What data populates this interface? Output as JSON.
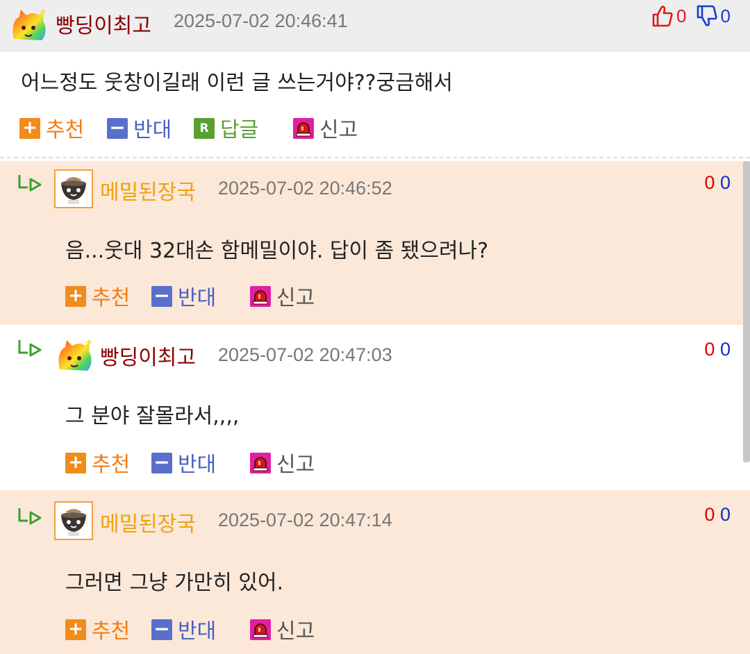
{
  "post": {
    "author": "빵딩이최고",
    "datetime": "2025-07-02 20:46:41",
    "upvotes": "0",
    "downvotes": "0",
    "body": "어느정도 웃창이길래 이런 글 쓰는거야??궁금해서",
    "actions": {
      "recommend": "추천",
      "oppose": "반대",
      "reply": "답글",
      "reply_icon": "R",
      "report": "신고"
    }
  },
  "comments": [
    {
      "author": "메밀된장국",
      "datetime": "2025-07-02 20:46:52",
      "upvotes": "0",
      "downvotes": "0",
      "body": "음...웃대 32대손 함메밀이야. 답이 좀 됐으려나?",
      "recommend": "추천",
      "oppose": "반대",
      "report": "신고"
    },
    {
      "author": "빵딩이최고",
      "datetime": "2025-07-02 20:47:03",
      "upvotes": "0",
      "downvotes": "0",
      "body": "그 분야 잘몰라서,,,,",
      "recommend": "추천",
      "oppose": "반대",
      "report": "신고"
    },
    {
      "author": "메밀된장국",
      "datetime": "2025-07-02 20:47:14",
      "upvotes": "0",
      "downvotes": "0",
      "body": "그러면 그냥 가만히 있어.",
      "recommend": "추천",
      "oppose": "반대",
      "report": "신고"
    }
  ],
  "colors": {
    "header_bg": "#eeeeee",
    "comment_peach": "#fbe8d8",
    "author_dark_red": "#8b0000",
    "author_orange": "#f0a010",
    "recommend_orange": "#f07d14",
    "oppose_blue": "#4a5ec0",
    "reply_green": "#5aa030",
    "report_magenta": "#e020a0",
    "upvote_red": "#e00000",
    "downvote_blue": "#1030c0"
  },
  "icons": {
    "thumbs_up": "thumbs-up-icon",
    "thumbs_down": "thumbs-down-icon",
    "plus": "plus-icon",
    "minus": "minus-icon",
    "reply": "reply-r-icon",
    "report": "siren-icon",
    "reply_arrow": "reply-arrow-icon"
  }
}
